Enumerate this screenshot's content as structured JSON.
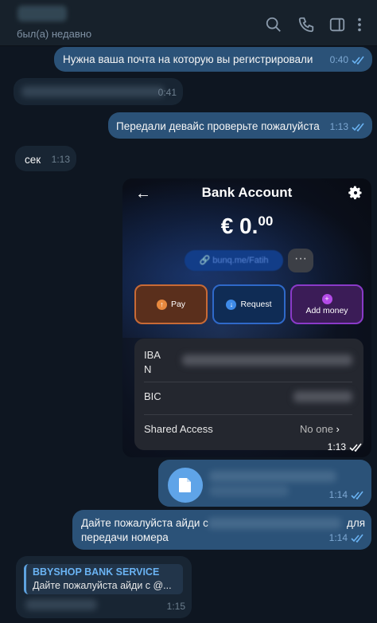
{
  "header": {
    "status": "был(а) недавно",
    "icons": [
      "search-icon",
      "phone-icon",
      "sidebar-icon",
      "more-vertical-icon"
    ]
  },
  "messages": {
    "m1": {
      "text": "Нужна ваша почта на которую вы регистрировали",
      "time": "0:40"
    },
    "m2": {
      "time": "0:41"
    },
    "m3": {
      "text": "Передали девайс проверьте пожалуйста",
      "time": "1:13"
    },
    "m4": {
      "text": "сек",
      "time": "1:13"
    },
    "m5": {
      "time": "1:13"
    },
    "m6": {
      "time": "1:14"
    },
    "m7": {
      "text_start": "Дайте пожалуйста айди с",
      "text_end": "для",
      "line2": "передачи номера",
      "time": "1:14"
    },
    "m8": {
      "reply_title": "BBYSHOP BANK SERVICE",
      "reply_text": "Дайте пожалуйста айди с @...",
      "time": "1:15"
    }
  },
  "bank_screen": {
    "title": "Bank Account",
    "balance_main": "€ 0.",
    "balance_cents": "00",
    "link": "bunq.me/Fatih",
    "more": "···",
    "actions": [
      "Pay",
      "Request",
      "Add money"
    ],
    "iban_label_1": "IBA",
    "iban_label_2": "N",
    "bic_label": "BIC",
    "shared_label": "Shared Access",
    "shared_value": "No one"
  },
  "colors": {
    "background": "#0e1621",
    "outgoing_bubble": "#2b5278",
    "incoming_bubble": "#182533",
    "accent": "#6ab3f3"
  }
}
